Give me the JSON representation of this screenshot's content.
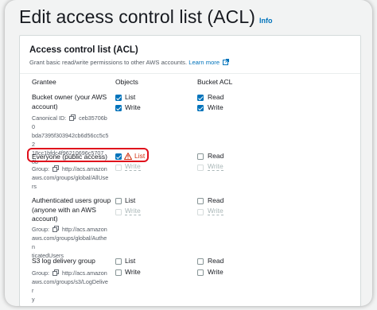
{
  "page": {
    "title": "Edit access control list (ACL)",
    "info_label": "Info"
  },
  "panel": {
    "title": "Access control list (ACL)",
    "description": "Grant basic read/write permissions to other AWS accounts.",
    "learn_more": "Learn more"
  },
  "columns": {
    "grantee": "Grantee",
    "objects": "Objects",
    "bucket_acl": "Bucket ACL"
  },
  "grantees": [
    {
      "name_line1": "Bucket owner (your AWS",
      "name_line2": "account)",
      "id_label": "Canonical ID:",
      "id_value_1": "ceb35706b0",
      "id_value_2": "bda7395f303942cb6d56cc5c52",
      "id_value_3": "18cc1bfdc4f96210696c5707",
      "id_value_4": "8b",
      "objects": [
        {
          "label": "List",
          "checked": true
        },
        {
          "label": "Write",
          "checked": true
        }
      ],
      "bucket_acl": [
        {
          "label": "Read",
          "checked": true
        },
        {
          "label": "Write",
          "checked": true
        }
      ]
    },
    {
      "name_line1": "Everyone (public access)",
      "group_label": "Group:",
      "group_1": "http://acs.amazon",
      "group_2": "aws.com/groups/global/AllUse",
      "group_3": "rs",
      "objects": [
        {
          "label": "List",
          "checked": true,
          "warning": true
        },
        {
          "label": "Write",
          "checked": false,
          "disabled": true
        }
      ],
      "bucket_acl": [
        {
          "label": "Read",
          "checked": false
        },
        {
          "label": "Write",
          "checked": false,
          "disabled": true
        }
      ]
    },
    {
      "name_line1": "Authenticated users group",
      "name_line2": "(anyone with an AWS",
      "name_line3": "account)",
      "group_label": "Group:",
      "group_1": "http://acs.amazon",
      "group_2": "aws.com/groups/global/Authen",
      "group_3": "ticatedUsers",
      "objects": [
        {
          "label": "List",
          "checked": false
        },
        {
          "label": "Write",
          "checked": false,
          "disabled": true
        }
      ],
      "bucket_acl": [
        {
          "label": "Read",
          "checked": false
        },
        {
          "label": "Write",
          "checked": false,
          "disabled": true
        }
      ]
    },
    {
      "name_line1": "S3 log delivery group",
      "group_label": "Group:",
      "group_1": "http://acs.amazon",
      "group_2": "aws.com/groups/s3/LogDeliver",
      "group_3": "y",
      "objects": [
        {
          "label": "List",
          "checked": false
        },
        {
          "label": "Write",
          "checked": false
        }
      ],
      "bucket_acl": [
        {
          "label": "Read",
          "checked": false
        },
        {
          "label": "Write",
          "checked": false
        }
      ]
    }
  ],
  "colors": {
    "accent": "#0073bb",
    "warning": "#d13212",
    "highlight": "#e0101c"
  }
}
